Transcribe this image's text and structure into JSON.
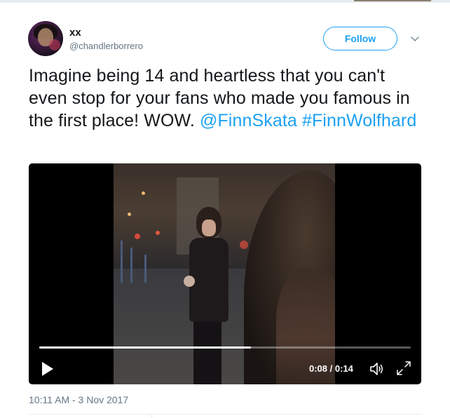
{
  "tweet": {
    "author": {
      "display_name": "xx",
      "handle": "@chandlerborrero"
    },
    "follow_label": "Follow",
    "text_plain": "Imagine being 14 and heartless that you can't even stop for your fans who made you famous in the first place! WOW.",
    "mention": "@FinnSkata",
    "hashtag": "#FinnWolfhard",
    "timestamp": "10:11 AM - 3 Nov 2017"
  },
  "video": {
    "time_display": "0:08 / 0:14",
    "progress_fraction": 0.57,
    "icons": {
      "play": "play-icon",
      "volume": "volume-icon",
      "fullscreen": "fullscreen-icon"
    }
  },
  "colors": {
    "accent": "#1da1f2",
    "text": "#14171a",
    "muted": "#657786"
  }
}
